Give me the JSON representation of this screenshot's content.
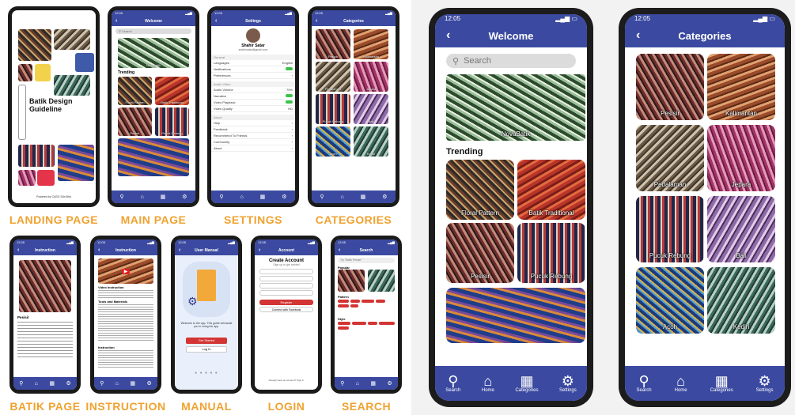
{
  "captions": [
    "LANDING PAGE",
    "MAIN PAGE",
    "SETTINGS",
    "CATEGORIES",
    "BATIK PAGE",
    "INSTRUCTION",
    "MANUAL",
    "LOGIN",
    "SEARCH"
  ],
  "status_time": "12:05",
  "landing": {
    "title": "Batik Design Guideline",
    "footer": "Powered by CASO Sdn Bhd"
  },
  "welcome": {
    "title": "Welcome",
    "search_placeholder": "Search",
    "hero_label": "NovaBatik",
    "trending_heading": "Trending",
    "trending": [
      "Floral Pattern",
      "Batik Traditional",
      "Pesisir",
      "Pucuk Rebung"
    ]
  },
  "settings": {
    "title": "Settings",
    "user_name": "Shahir Satar",
    "user_email": "shahirsatar@gmail.com",
    "sections": [
      {
        "header": "General",
        "rows": [
          {
            "label": "Languages",
            "value": "English"
          },
          {
            "label": "Notifications",
            "value": ""
          },
          {
            "label": "Preferences",
            "value": ""
          }
        ]
      },
      {
        "header": "Audio Video",
        "rows": [
          {
            "label": "Audio Volume",
            "value": "70%"
          },
          {
            "label": "Narrative",
            "value": ""
          },
          {
            "label": "Video Playback",
            "value": ""
          },
          {
            "label": "Video Quality",
            "value": "HD"
          }
        ]
      },
      {
        "header": "About",
        "rows": [
          {
            "label": "Help",
            "value": ""
          },
          {
            "label": "Feedback",
            "value": ""
          },
          {
            "label": "Recommend To Friends",
            "value": ""
          },
          {
            "label": "Community",
            "value": ""
          },
          {
            "label": "About",
            "value": ""
          }
        ]
      }
    ]
  },
  "categories": {
    "title": "Categories",
    "items": [
      "Pesisir",
      "Kalimantan",
      "Pedalaman",
      "Jepara",
      "Pucuk Rebung",
      "Bali",
      "Acoh",
      "Kediri"
    ]
  },
  "batik_page": {
    "title": "Instruction",
    "heading": "Pesisir"
  },
  "instruction": {
    "title": "Instruction",
    "h1": "Video Instruction",
    "h2": "Tools and Materials",
    "h3": "Instruction"
  },
  "manual": {
    "title": "User Manual",
    "text": "Welcome to the app. This guide will assist you in using the app.",
    "start_label": "Get Started",
    "login_label": "Log In"
  },
  "login": {
    "title": "Account",
    "heading": "Create Account",
    "sub": "Sign up to get started",
    "register_label": "Register",
    "fb_label": "Connect with Facebook",
    "footer": "Already have an account? Sign in"
  },
  "search": {
    "title": "Search",
    "placeholder": "Try \"Batik Pesisir\"",
    "popular_label": "Popular",
    "pattern_label": "Pattern",
    "style_label": "Style"
  },
  "nav": [
    {
      "label": "Search",
      "icon": "search-icon",
      "glyph": "⚲"
    },
    {
      "label": "Home",
      "icon": "home-icon",
      "glyph": "⌂"
    },
    {
      "label": "Categories",
      "icon": "grid-icon",
      "glyph": "▦"
    },
    {
      "label": "Settings",
      "icon": "gear-icon",
      "glyph": "⚙"
    }
  ],
  "colors": {
    "brand": "#3b4aa0",
    "caption": "#f0a230",
    "toggle_on": "#3cc24a",
    "register": "#d33434"
  }
}
